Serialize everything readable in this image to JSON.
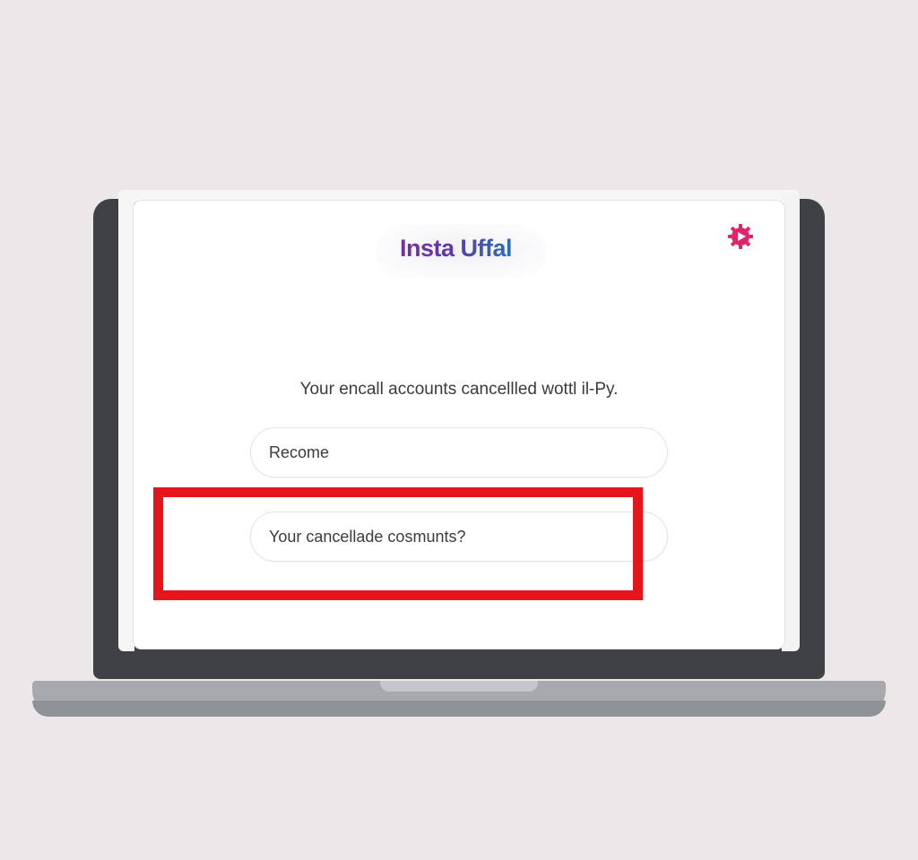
{
  "app": {
    "logo_text": "Insta Uffal"
  },
  "colors": {
    "background": "#ece8ea",
    "bezel": "#3f4144",
    "screen": "#ffffff",
    "logo_gradient_start": "#7a2f9a",
    "logo_gradient_end": "#2a6fb3",
    "settings_icon": "#e0246a",
    "highlight": "#e4161c"
  },
  "icons": {
    "settings": "gear-play-icon"
  },
  "main": {
    "message": "Your encall accounts cancellled wottl il-Py.",
    "fields": [
      {
        "value": "Recome"
      },
      {
        "value": "Your cancellade cosmunts?"
      }
    ]
  }
}
